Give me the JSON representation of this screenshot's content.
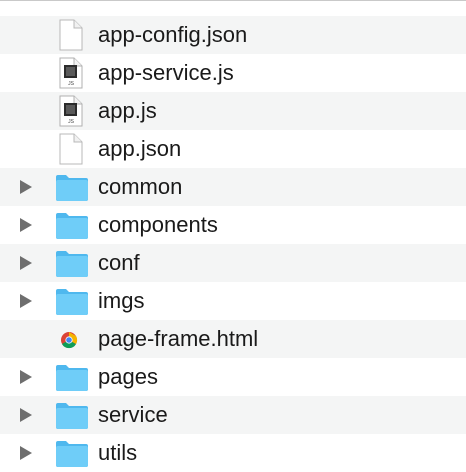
{
  "file_list": {
    "items": [
      {
        "name": "app-config.json",
        "kind": "file",
        "icon": "document-icon",
        "expandable": false
      },
      {
        "name": "app-service.js",
        "kind": "file",
        "icon": "js-file-icon",
        "expandable": false
      },
      {
        "name": "app.js",
        "kind": "file",
        "icon": "js-file-icon",
        "expandable": false
      },
      {
        "name": "app.json",
        "kind": "file",
        "icon": "document-icon",
        "expandable": false
      },
      {
        "name": "common",
        "kind": "folder",
        "icon": "folder-icon",
        "expandable": true
      },
      {
        "name": "components",
        "kind": "folder",
        "icon": "folder-icon",
        "expandable": true
      },
      {
        "name": "conf",
        "kind": "folder",
        "icon": "folder-icon",
        "expandable": true
      },
      {
        "name": "imgs",
        "kind": "folder",
        "icon": "folder-icon",
        "expandable": true
      },
      {
        "name": "page-frame.html",
        "kind": "file",
        "icon": "chrome-html-icon",
        "expandable": false
      },
      {
        "name": "pages",
        "kind": "folder",
        "icon": "folder-icon",
        "expandable": true
      },
      {
        "name": "service",
        "kind": "folder",
        "icon": "folder-icon",
        "expandable": true
      },
      {
        "name": "utils",
        "kind": "folder",
        "icon": "folder-icon",
        "expandable": true
      }
    ],
    "colors": {
      "row_alt": "#f4f5f5",
      "row_base": "#ffffff",
      "folder": "#5ec6f5",
      "disclosure": "#6e6e6e",
      "text": "#1a1a1a"
    }
  }
}
